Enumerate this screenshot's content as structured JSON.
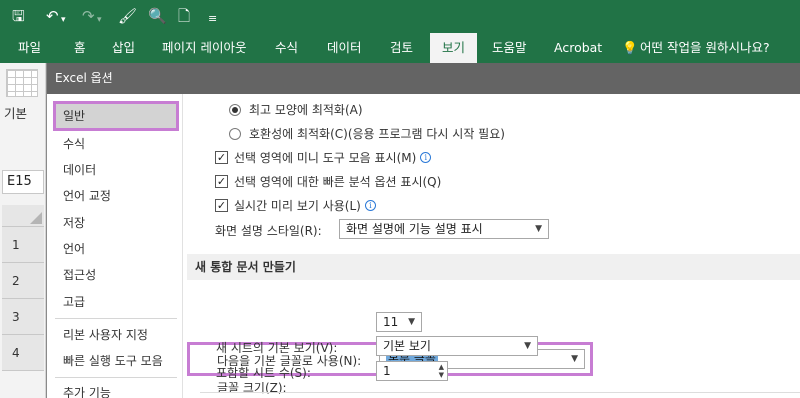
{
  "qat": {
    "save_icon": "save-icon",
    "undo_icon": "undo-icon",
    "redo_icon": "redo-icon",
    "format_painter_icon": "brush-icon",
    "preview_icon": "print-preview-icon",
    "new_icon": "new-file-icon",
    "customize_icon": "qat-customize-icon"
  },
  "menu": {
    "file": "파일",
    "home": "홈",
    "insert": "삽입",
    "page_layout": "페이지 레이아웃",
    "formulas": "수식",
    "data": "데이터",
    "review": "검토",
    "view": "보기",
    "help": "도움말",
    "acrobat": "Acrobat",
    "tell_me": "어떤 작업을 원하시나요?"
  },
  "sheet": {
    "left_label": "기본",
    "name_box": "E15",
    "rows": [
      "1",
      "2",
      "3",
      "4"
    ]
  },
  "dialog": {
    "title": "Excel 옵션",
    "nav": [
      "일반",
      "수식",
      "데이터",
      "언어 교정",
      "저장",
      "언어",
      "접근성",
      "고급",
      "리본 사용자 지정",
      "빠른 실행 도구 모음",
      "추가 기능"
    ],
    "options": {
      "radio_best_appearance": "최고 모양에 최적화(A)",
      "radio_compat": "호환성에 최적화(C)(응용 프로그램 다시 시작 필요)",
      "check_mini_toolbar": "선택 영역에 미니 도구 모음 표시(M)",
      "check_quick_analysis": "선택 영역에 대한 빠른 분석 옵션 표시(Q)",
      "check_live_preview": "실시간 미리 보기 사용(L)",
      "screentip_label": "화면 설명 스타일(R):",
      "screentip_value": "화면 설명에 기능 설명 표시"
    },
    "new_workbook": {
      "section_title": "새 통합 문서 만들기",
      "font_label": "다음을 기본 글꼴로 사용(N):",
      "font_value": "본문 글꼴",
      "size_label": "글꼴 크기(Z):",
      "size_value": "11",
      "view_label": "새 시트의 기본 보기(V):",
      "view_value": "기본 보기",
      "sheets_label": "포함할 시트 수(S):",
      "sheets_value": "1"
    }
  },
  "colors": {
    "ribbon": "#217346",
    "dialog_title": "#646464",
    "highlight": "#c77dd3"
  }
}
